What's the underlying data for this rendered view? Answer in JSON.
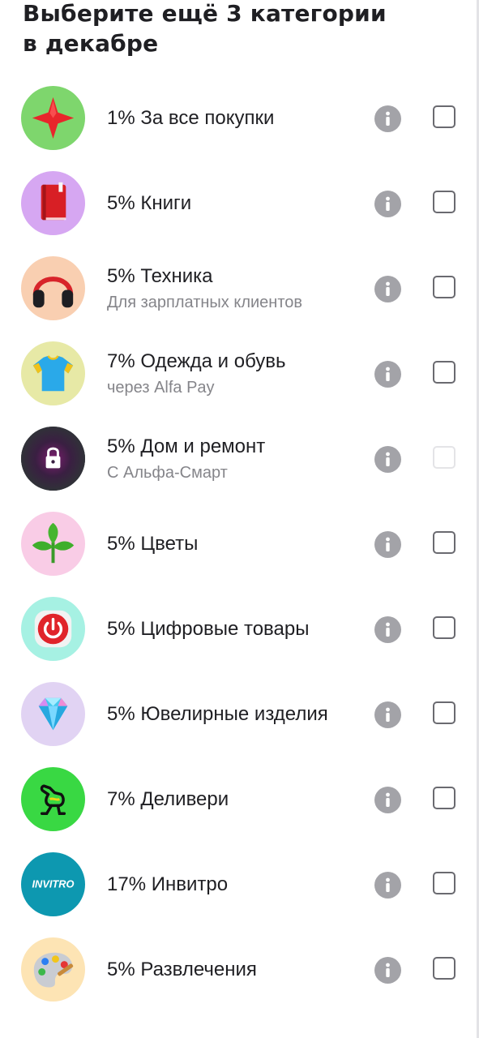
{
  "header": {
    "title_line1": "Выберите ещё 3 категории",
    "title_line2": "в декабре"
  },
  "categories": [
    {
      "title": "1% За все покупки",
      "subtitle": "",
      "icon": "red-star-icon",
      "bg": "#7ed66d",
      "enabled": true
    },
    {
      "title": "5% Книги",
      "subtitle": "",
      "icon": "book-icon",
      "bg": "#d6a7f2",
      "enabled": true
    },
    {
      "title": "5% Техника",
      "subtitle": "Для зарплатных клиентов",
      "icon": "headphones-icon",
      "bg": "#f9cfb1",
      "enabled": true
    },
    {
      "title": "7% Одежда и обувь",
      "subtitle": "через Alfa Pay",
      "icon": "tshirt-icon",
      "bg": "#e7e9a6",
      "enabled": true
    },
    {
      "title": "5% Дом и ремонт",
      "subtitle": "С Альфа-Смарт",
      "icon": "lock-icon",
      "bg": "#3a3d44",
      "enabled": false
    },
    {
      "title": "5% Цветы",
      "subtitle": "",
      "icon": "sprout-icon",
      "bg": "#f9cce6",
      "enabled": true
    },
    {
      "title": "5% Цифровые товары",
      "subtitle": "",
      "icon": "power-button-icon",
      "bg": "#a6f1e3",
      "enabled": true
    },
    {
      "title": "5% Ювелирные изделия",
      "subtitle": "",
      "icon": "diamond-icon",
      "bg": "#e1d3f3",
      "enabled": true
    },
    {
      "title": "7% Деливери",
      "subtitle": "",
      "icon": "ostrich-icon",
      "bg": "#39d843",
      "enabled": true
    },
    {
      "title": "17% Инвитро",
      "subtitle": "",
      "icon": "invitro-logo-icon",
      "bg": "#0d98b0",
      "logo_text": "INVITRO",
      "enabled": true
    },
    {
      "title": "5% Развлечения",
      "subtitle": "",
      "icon": "paint-palette-icon",
      "bg": "#fde4b4",
      "enabled": true
    }
  ]
}
